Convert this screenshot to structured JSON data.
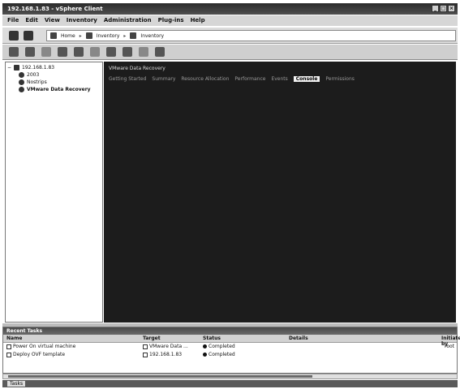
{
  "window": {
    "title": "192.168.1.83 - vSphere Client"
  },
  "menu": [
    "File",
    "Edit",
    "View",
    "Inventory",
    "Administration",
    "Plug-ins",
    "Help"
  ],
  "nav": {
    "crumbs": [
      "Home",
      "Inventory",
      "Inventory"
    ]
  },
  "tree": {
    "root": "192.168.1.83",
    "items": [
      "2003",
      "Nostrips",
      "VMware Data Recovery"
    ]
  },
  "main": {
    "title": "VMware Data Recovery",
    "tabs": [
      "Getting Started",
      "Summary",
      "Resource Allocation",
      "Performance",
      "Events",
      "Console",
      "Permissions"
    ],
    "active_tab": "Console"
  },
  "recent_tasks": {
    "title": "Recent Tasks",
    "columns": {
      "name": "Name",
      "target": "Target",
      "status": "Status",
      "details": "Details",
      "initiated_by": "Initiated by"
    },
    "rows": [
      {
        "name": "Power On virtual machine",
        "target": "VMware Data ...",
        "status": "Completed",
        "initiated_by": "root"
      },
      {
        "name": "Deploy OVF template",
        "target": "192.168.1.83",
        "status": "Completed",
        "initiated_by": ""
      }
    ]
  },
  "status": {
    "tasks_label": "Tasks"
  },
  "colors": {
    "console_bg": "#1c1c1c",
    "active_tab_bg": "#f2f2f2",
    "header_dark": "#4a4a4a"
  }
}
